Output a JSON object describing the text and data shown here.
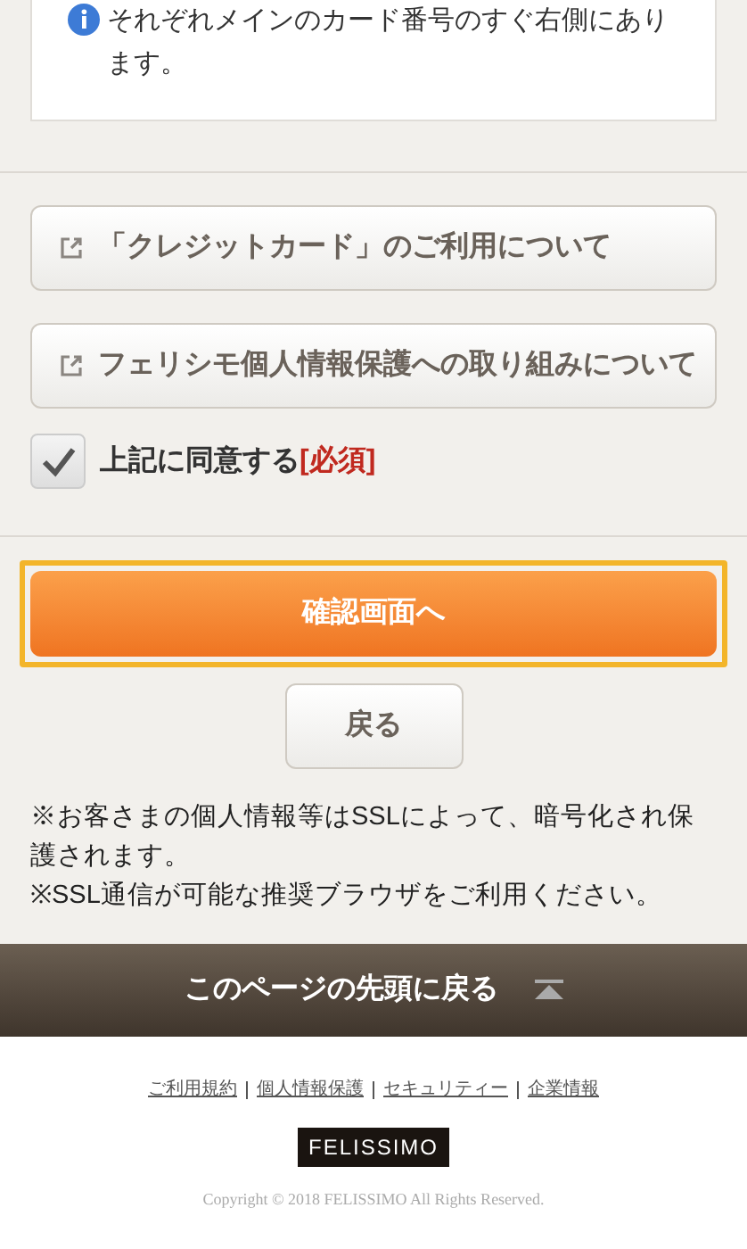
{
  "info_card": {
    "text": "それぞれメインのカード番号のすぐ右側にあります。"
  },
  "link_buttons": [
    {
      "label": "「クレジットカード」のご利用について"
    },
    {
      "label": "フェリシモ個人情報保護への取り組みについて"
    }
  ],
  "agreement": {
    "label": "上記に同意する",
    "required": "[必須]",
    "checked": true
  },
  "confirm_button": {
    "label": "確認画面へ"
  },
  "back_button": {
    "label": "戻る"
  },
  "notes": [
    "※お客さまの個人情報等はSSLによって、暗号化され保護されます。",
    "※SSL通信が可能な推奨ブラウザをご利用ください。"
  ],
  "page_top": {
    "label": "このページの先頭に戻る"
  },
  "footer_links": [
    "ご利用規約",
    "個人情報保護",
    "セキュリティー",
    "企業情報"
  ],
  "logo": "FELISSIMO",
  "copyright": "Copyright © 2018 FELISSIMO All Rights Reserved."
}
